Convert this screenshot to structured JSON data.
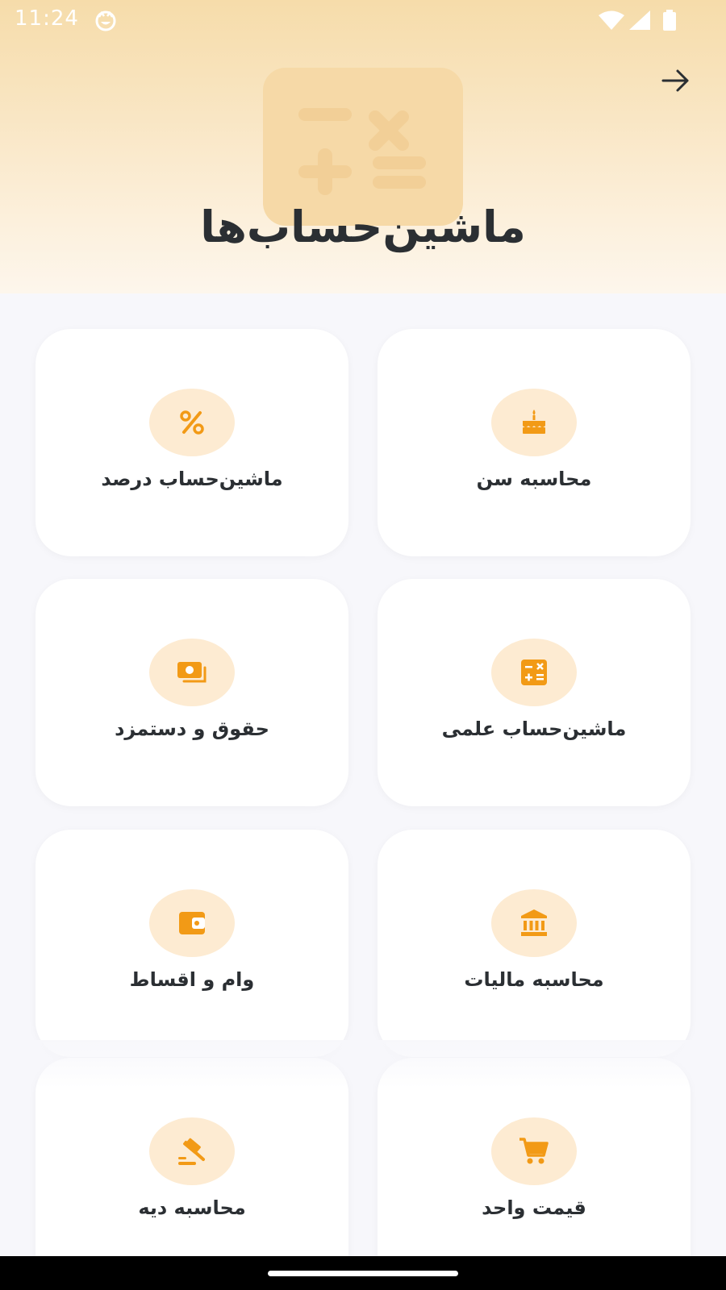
{
  "status_bar": {
    "time": "11:24",
    "app_icon": "smiley-notification-icon",
    "wifi_icon": "wifi-icon",
    "signal_icon": "cell-signal-icon",
    "battery_icon": "battery-icon"
  },
  "header": {
    "title": "ماشین‌حساب‌ها",
    "back_icon": "arrow-right-icon",
    "illustration_icon": "calculator-icon"
  },
  "colors": {
    "accent": "#f29a16",
    "icon_bg": "#fdebd2",
    "card_bg": "#ffffff",
    "page_bg": "#f7f7fb",
    "text": "#2b2f33",
    "hero_top": "#f6dcaa"
  },
  "cards": [
    {
      "label": "محاسبه سن",
      "icon": "birthday-cake-icon"
    },
    {
      "label": "ماشین‌حساب درصد",
      "icon": "percent-icon"
    },
    {
      "label": "ماشین‌حساب علمی",
      "icon": "calculator-icon"
    },
    {
      "label": "حقوق و دستمزد",
      "icon": "money-icon"
    },
    {
      "label": "محاسبه مالیات",
      "icon": "bank-icon"
    },
    {
      "label": "وام و اقساط",
      "icon": "wallet-icon"
    },
    {
      "label": "قیمت واحد",
      "icon": "shopping-cart-icon"
    },
    {
      "label": "محاسبه دیه",
      "icon": "gavel-icon"
    }
  ]
}
